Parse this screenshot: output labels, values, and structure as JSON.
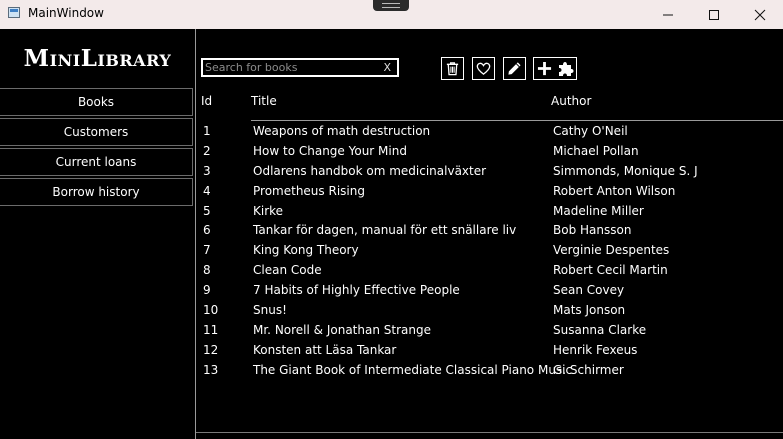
{
  "window": {
    "title": "MainWindow",
    "buttons": [
      "minimize",
      "maximize",
      "close"
    ]
  },
  "sidebar": {
    "logo": "MiniLibrary",
    "items": [
      {
        "label": "Books"
      },
      {
        "label": "Customers"
      },
      {
        "label": "Current loans"
      },
      {
        "label": "Borrow history"
      }
    ]
  },
  "search": {
    "placeholder": "Search for books",
    "value": "",
    "clear_label": "X"
  },
  "toolbar": {
    "icons": [
      "trash-icon",
      "heart-icon",
      "pencil-icon",
      "plus-icon",
      "puzzle-icon"
    ]
  },
  "table": {
    "headers": {
      "id": "Id",
      "title": "Title",
      "author": "Author"
    },
    "rows": [
      {
        "id": "1",
        "title": "Weapons of math destruction",
        "author": "Cathy O'Neil"
      },
      {
        "id": "2",
        "title": "How to Change Your Mind",
        "author": "Michael Pollan"
      },
      {
        "id": "3",
        "title": "Odlarens handbok om medicinalväxter",
        "author": "Simmonds, Monique S. J"
      },
      {
        "id": "4",
        "title": "Prometheus Rising",
        "author": "Robert Anton Wilson"
      },
      {
        "id": "5",
        "title": "Kirke",
        "author": "Madeline Miller"
      },
      {
        "id": "6",
        "title": "Tankar för dagen, manual för ett snällare liv",
        "author": "Bob Hansson"
      },
      {
        "id": "7",
        "title": "King Kong Theory",
        "author": "Verginie Despentes"
      },
      {
        "id": "8",
        "title": "Clean Code",
        "author": "Robert Cecil Martin"
      },
      {
        "id": "9",
        "title": "7 Habits of Highly Effective People",
        "author": "Sean Covey"
      },
      {
        "id": "10",
        "title": "Snus!",
        "author": "Mats Jonson"
      },
      {
        "id": "11",
        "title": "Mr. Norell & Jonathan Strange",
        "author": "Susanna Clarke"
      },
      {
        "id": "12",
        "title": "Konsten att Läsa Tankar",
        "author": "Henrik Fexeus"
      },
      {
        "id": "13",
        "title": "The Giant Book of Intermediate Classical Piano Music",
        "author": "G. Schirmer"
      }
    ]
  },
  "colors": {
    "background": "#000000",
    "titlebar": "#f3eaea",
    "text": "#ffffff",
    "border": "#9a9a9a"
  }
}
